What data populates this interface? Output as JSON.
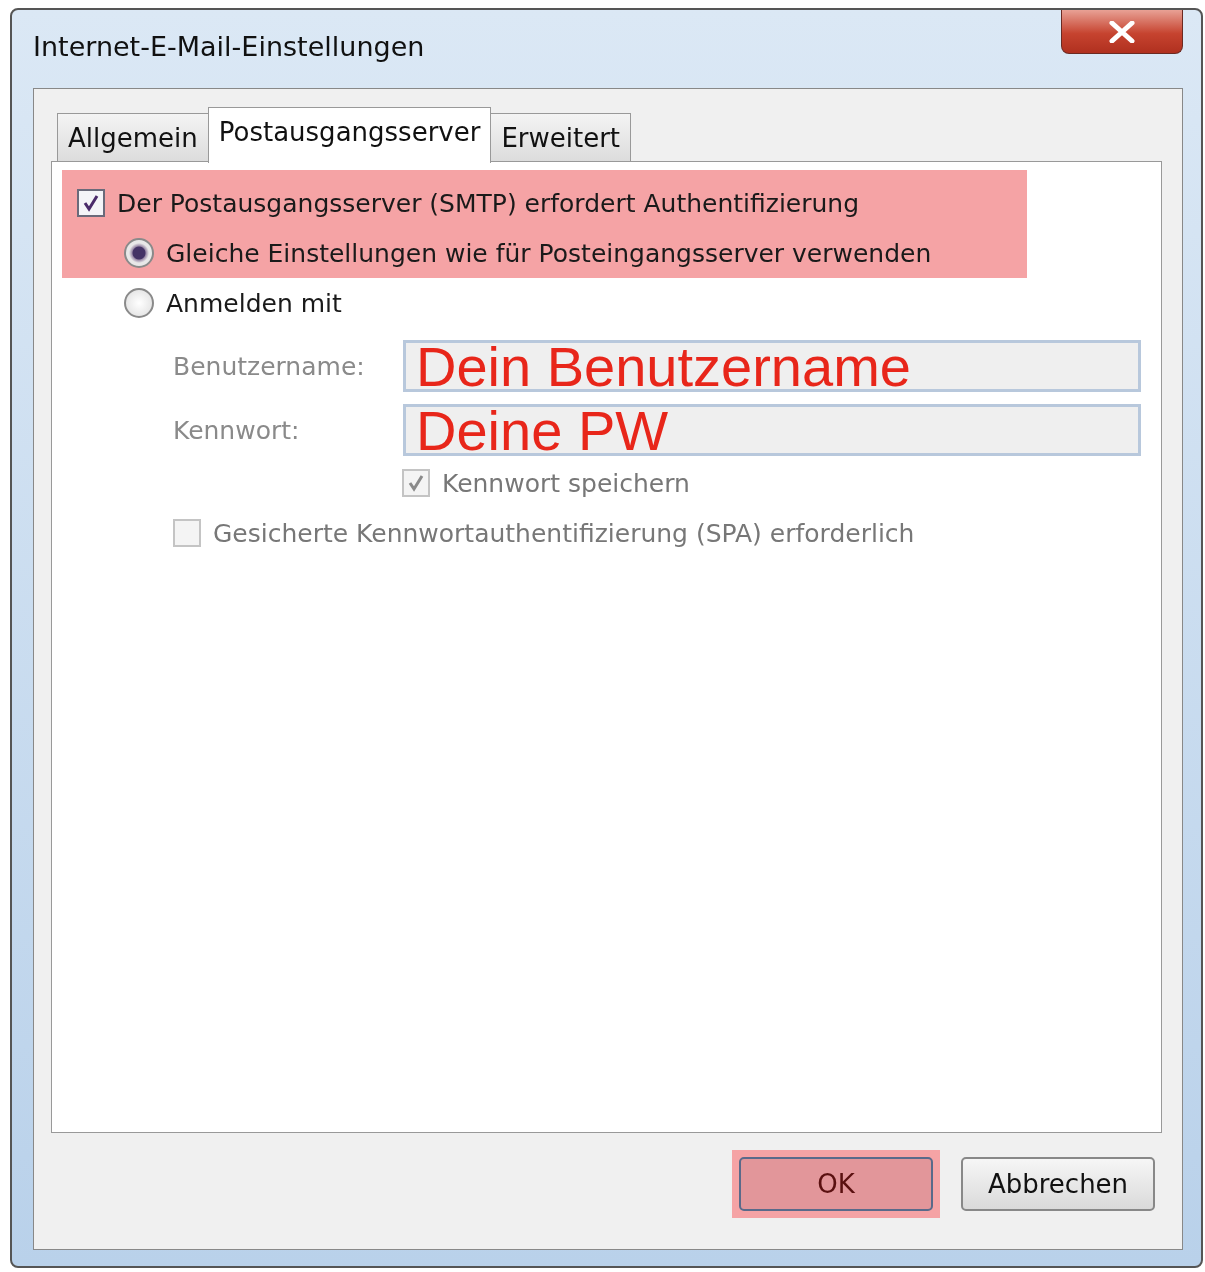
{
  "window": {
    "title": "Internet-E-Mail-Einstellungen"
  },
  "tabs": [
    {
      "label": "Allgemein",
      "selected": false
    },
    {
      "label": "Postausgangsserver",
      "selected": true
    },
    {
      "label": "Erweitert",
      "selected": false
    }
  ],
  "auth": {
    "label": "Der Postausgangsserver (SMTP) erfordert Authentifizierung",
    "checked": true,
    "highlighted": true
  },
  "login_options": [
    {
      "label": "Gleiche Einstellungen wie für Posteingangsserver verwenden",
      "selected": true,
      "highlighted": true
    },
    {
      "label": "Anmelden mit",
      "selected": false,
      "highlighted": false
    }
  ],
  "credentials": [
    {
      "label": "Benutzername:",
      "value": "Dein Benutzername",
      "disabled": true
    },
    {
      "label": "Kennwort:",
      "value": "Deine PW",
      "disabled": true
    }
  ],
  "save_password": {
    "label": "Kennwort speichern",
    "checked": true,
    "disabled": true
  },
  "spa": {
    "label": "Gesicherte Kennwortauthentifizierung (SPA) erforderlich",
    "checked": false,
    "disabled": true
  },
  "buttons": [
    {
      "label": "OK",
      "highlighted": true
    },
    {
      "label": "Abbrechen",
      "highlighted": false
    }
  ]
}
